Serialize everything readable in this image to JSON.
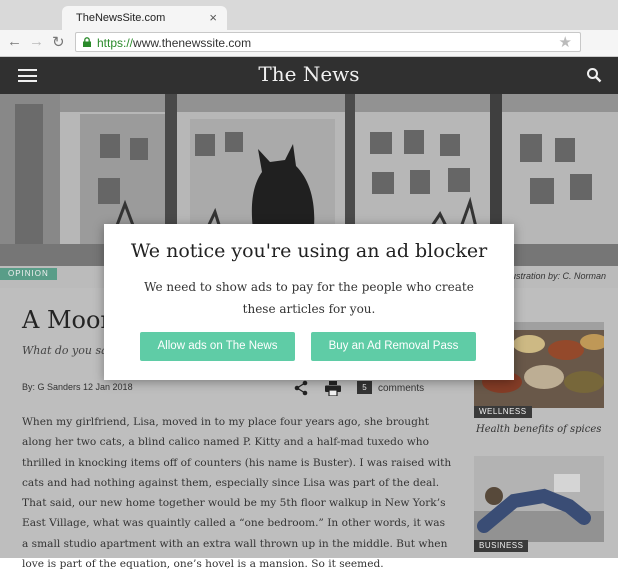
{
  "browser": {
    "tab_title": "TheNewsSite.com",
    "tab_close": "×",
    "url_scheme": "https://",
    "url_rest": "www.thenewssite.com"
  },
  "site": {
    "title": "The News"
  },
  "hero": {
    "category": "OPINION",
    "caption": "Illustration by: C. Norman"
  },
  "article": {
    "headline": "A Moon",
    "subhead": "What do you sa",
    "byline": "By: G Sanders  12 Jan 2018",
    "comment_count": "5",
    "comments_label": "comments",
    "paragraph": "When my girlfriend, Lisa, moved in to my place four years ago, she brought along her two cats, a blind calico named P. Kitty and a half-mad tuxedo who thrilled in knocking items off of counters (his name is Buster). I was raised with cats and had nothing against them, especially since Lisa was part of the deal. That said, our new home together would be my 5th floor walkup in New York’s East Village, what was quaintly called a “one bedroom.” In other words, it was a small studio apartment with an extra wall thrown up in the middle. But when love is part of the equation, one’s hovel is a mansion. So it seemed."
  },
  "sidebar": {
    "items": [
      {
        "tag": "WELLNESS",
        "title": "Health benefits of spices"
      },
      {
        "tag": "BUSINESS",
        "title": ""
      }
    ]
  },
  "modal": {
    "title": "We notice you're using an ad blocker",
    "text": "We need to show ads to pay for the people who create these articles for you.",
    "allow_label": "Allow ads on The News",
    "buy_label": "Buy an Ad Removal Pass",
    "accent": "#5fcca6"
  }
}
